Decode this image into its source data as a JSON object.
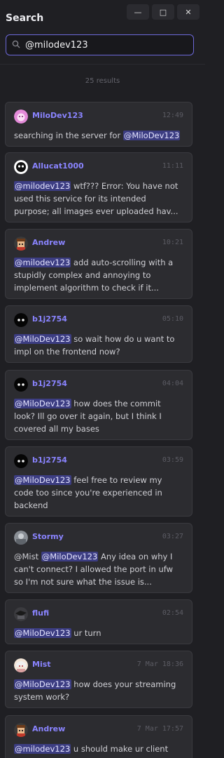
{
  "header": {
    "title": "Search"
  },
  "window": {
    "minimize": "—",
    "maximize": "□",
    "close": "✕"
  },
  "search": {
    "value": "@milodev123",
    "placeholder": ""
  },
  "results": {
    "count_label": "25 results"
  },
  "messages": [
    {
      "user": "MiloDev123",
      "time": "12:49",
      "line1": {
        "pre": "searching in the server for ",
        "mention": "@MiloDev123",
        "post": ""
      }
    },
    {
      "user": "Allucat1000",
      "time": "11:11",
      "line1": {
        "pre": "",
        "mention": "@milodev123",
        "post": " wtf??? Error: You have not"
      },
      "line2": "used this service for its intended",
      "line3": "purpose; all images ever uploaded hav..."
    },
    {
      "user": "Andrew",
      "time": "10:21",
      "line1": {
        "pre": "",
        "mention": "@milodev123",
        "post": " add auto-scrolling with a"
      },
      "line2": "stupidly complex and annoying to",
      "line3": "implement algorithm to check if it..."
    },
    {
      "user": "b1j2754",
      "time": "05:10",
      "line1": {
        "pre": "",
        "mention": "@MiloDev123",
        "post": " so wait how do u want to"
      },
      "line2": "impl on the frontend now?"
    },
    {
      "user": "b1j2754",
      "time": "04:04",
      "line1": {
        "pre": "",
        "mention": "@MiloDev123",
        "post": " how does the commit"
      },
      "line2": "look? Ill go over it again, but I think I",
      "line3": "covered all my bases"
    },
    {
      "user": "b1j2754",
      "time": "03:59",
      "line1": {
        "pre": "",
        "mention": "@MiloDev123",
        "post": " feel free to review my"
      },
      "line2": "code too since you're experienced in",
      "line3": "backend"
    },
    {
      "user": "Stormy",
      "time": "03:27",
      "line1": {
        "pre": "@Mist ",
        "mention": "@MiloDev123",
        "post": " Any idea on why I"
      },
      "line2": "can't connect? I allowed the port in ufw",
      "line3": "so I'm not sure what the issue is..."
    },
    {
      "user": "flufi",
      "time": "02:54",
      "line1": {
        "pre": "",
        "mention": "@MiloDev123",
        "post": " ur turn"
      }
    },
    {
      "user": "Mist",
      "time": "7 Mar 18:36",
      "line1": {
        "pre": "",
        "mention": "@MiloDev123",
        "post": " how does your streaming"
      },
      "line2": "system work?"
    },
    {
      "user": "Andrew",
      "time": "7 Mar 17:57",
      "line1": {
        "pre": "",
        "mention": "@milodev123",
        "post": " u should make ur client"
      }
    }
  ],
  "colors": {
    "accent": "#8a84ff",
    "mention_bg": "#3c3d82",
    "background": "#1f1f23",
    "card": "#2c2c30"
  }
}
